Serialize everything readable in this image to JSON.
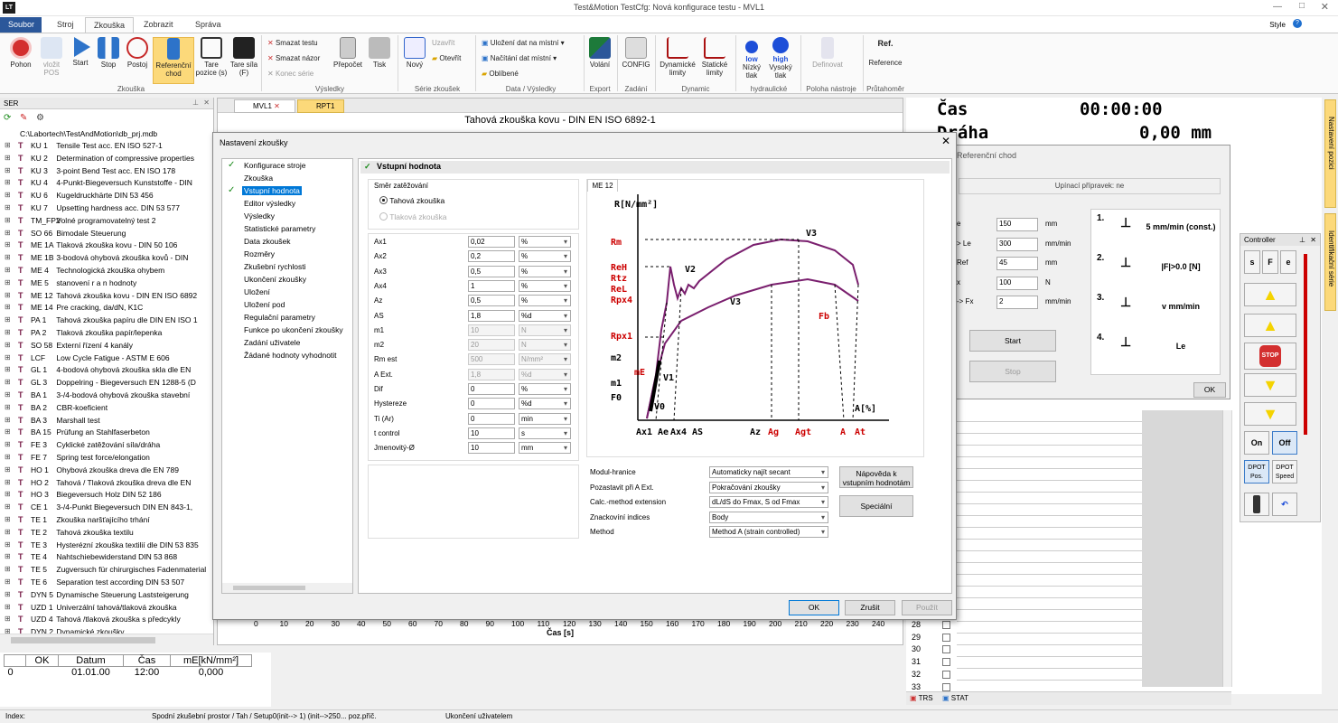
{
  "titlebar": {
    "title": "Test&Motion  TestCfg: Nová konfigurace testu - MVL1",
    "style": "Style"
  },
  "ribbon_tabs": [
    "Soubor",
    "Stroj",
    "Zkouška",
    "Zobrazit",
    "Správa"
  ],
  "ribbon": {
    "buttons": [
      {
        "label": "Pohon",
        "name": "pohon-button"
      },
      {
        "label": "vložit POS",
        "name": "vlozit-pos-button"
      },
      {
        "label": "Start",
        "name": "start-button"
      },
      {
        "label": "Stop",
        "name": "stop-button"
      },
      {
        "label": "Postoj",
        "name": "postoj-button"
      },
      {
        "label": "Referenční chod",
        "name": "referencni-chod-button"
      },
      {
        "label": "Tare pozice (s)",
        "name": "tare-pozice-button"
      },
      {
        "label": "Tare síla (F)",
        "name": "tare-sila-button"
      }
    ],
    "small_items": [
      "Smazat testu",
      "Smazat názor",
      "Konec série",
      "Přepočet",
      "Tisk",
      "Nový",
      "Uzavřít",
      "Otevřít",
      "Uložení dat na místní",
      "Načítání dat místní",
      "Oblíbené",
      "Volání",
      "CONFIG",
      "Dynamické limity",
      "Statické limity",
      "Nízký tlak",
      "Vysoký tlak",
      "Definovat",
      "Reference"
    ],
    "groups": [
      "Zkouška",
      "Výsledky",
      "Série zkoušek",
      "Data / Výsledky",
      "Export",
      "Zadání",
      "Dynamic",
      "hydraulické",
      "Poloha nástroje",
      "Průtahoměr"
    ],
    "icon_text": {
      "low": "low",
      "high": "high",
      "ref": "Ref."
    }
  },
  "left_panel": {
    "title": "SER",
    "path": "C:\\Labortech\\TestAndMotion\\db_prj.mdb",
    "items": [
      [
        "KU 1",
        "Tensile Test acc. EN ISO 527-1"
      ],
      [
        "KU 2",
        "Determination of compressive properties"
      ],
      [
        "KU 3",
        "3-point Bend Test acc. EN ISO 178"
      ],
      [
        "KU 4",
        "4-Punkt-Biegeversuch Kunststoffe - DIN"
      ],
      [
        "KU 6",
        "Kugeldruckhärte DIN 53 456"
      ],
      [
        "KU 7",
        "Upsetting hardness acc. DIN 53 577"
      ],
      [
        "TM_FP2",
        "Volné programovatelný test 2"
      ],
      [
        "SO 66",
        "Bimodale Steuerung"
      ],
      [
        "ME 1A",
        "Tlaková zkouška kovu - DIN 50 106"
      ],
      [
        "ME 1B",
        "3-bodová ohybová zkouška kovů - DIN"
      ],
      [
        "ME 4",
        "Technologická zkouška ohybem"
      ],
      [
        "ME 5",
        "stanovení r a n hodnoty"
      ],
      [
        "ME 12",
        "Tahová zkouška kovu - DIN EN ISO 6892"
      ],
      [
        "ME 14",
        "Pre cracking, da/dN, K1C"
      ],
      [
        "PA 1",
        "Tahová zkouška papíru dle DIN EN ISO 1"
      ],
      [
        "PA 2",
        "Tlaková zkouška papír/lepenka"
      ],
      [
        "SO 58",
        "Externí řízení 4 kanály"
      ],
      [
        "LCF",
        "Low Cycle Fatigue - ASTM E 606"
      ],
      [
        "GL 1",
        "4-bodová ohybová zkouška skla dle EN"
      ],
      [
        "GL 3",
        "Doppelring - Biegeversuch EN 1288-5 (D"
      ],
      [
        "BA 1",
        "3-/4-bodová ohybová zkouška stavební"
      ],
      [
        "BA 2",
        "CBR-koeficient"
      ],
      [
        "BA 3",
        "Marshall test"
      ],
      [
        "BA 15",
        "Prüfung an Stahlfaserbeton"
      ],
      [
        "FE 3",
        "Cyklické zatěžování síla/dráha"
      ],
      [
        "FE 7",
        "Spring test force/elongation"
      ],
      [
        "HO 1",
        "Ohybová zkouška dreva dle EN 789"
      ],
      [
        "HO 2",
        "Tahová / Tlaková zkouška dreva dle EN"
      ],
      [
        "HO 3",
        "Biegeversuch Holz  DIN 52 186"
      ],
      [
        "CE 1",
        "3-/4-Punkt Biegeversuch DIN EN 843-1,"
      ],
      [
        "TE 1",
        "Zkouška naršťajícího trhání"
      ],
      [
        "TE 2",
        "Tahová zkouška textilu"
      ],
      [
        "TE 3",
        "Hysterézní zkouška textilií dle DIN 53 835"
      ],
      [
        "TE 4",
        "Nahtschiebewiderstand DIN 53 868"
      ],
      [
        "TE 5",
        "Zugversuch für chirurgisches Fadenmaterial"
      ],
      [
        "TE 6",
        "Separation test according DIN 53 507"
      ],
      [
        "DYN 5",
        "Dynamische Steuerung Laststeigerung"
      ],
      [
        "UZD 1",
        "Univerzální tahová/tlaková zkouška"
      ],
      [
        "UZD 4",
        "Tahová /tlaková zkouška s předcykly"
      ],
      [
        "DYN 2",
        "Dynamické zkoušky"
      ]
    ]
  },
  "bottom_table": {
    "headers": [
      "OK",
      "Datum",
      "Čas",
      "mE[kN/mm²]"
    ],
    "row": [
      "0",
      "01.01.00",
      "12:00",
      "0,000"
    ]
  },
  "status_bar": {
    "index": "Index:",
    "text1": "Spodní zkušební prostor / Tah / Setup0(init--> 1)  (init-->250...  poz.příč.",
    "text2": "Ukončení uživatelem"
  },
  "doc": {
    "tabs": [
      "MVL1",
      "RPT1"
    ],
    "title": "Tahová zkouška kovu - DIN EN ISO 6892-1",
    "xaxis_ticks": [
      "0",
      "10",
      "20",
      "30",
      "40",
      "50",
      "60",
      "70",
      "80",
      "90",
      "100",
      "110",
      "120",
      "130",
      "140",
      "150",
      "160",
      "170",
      "180",
      "190",
      "200",
      "210",
      "220",
      "230",
      "240"
    ],
    "xlabel": "Čas [s]"
  },
  "right_panel": {
    "cas_label": "Čas",
    "cas_value": "00:00:00",
    "draha_label": "Dráha",
    "draha_value": "0,00 mm",
    "side_tabs": [
      "Nastavení pozici",
      "Identifikační série"
    ],
    "row_numbers": [
      "28",
      "29",
      "30",
      "31",
      "32",
      "33"
    ],
    "bottom_tabs": [
      "TRS",
      "STAT"
    ]
  },
  "ref_dialog": {
    "title": "Referenční chod",
    "fixture": "Upínací přípravek: ne",
    "rows": [
      {
        "label": "e",
        "value": "150",
        "unit": "mm"
      },
      {
        "label": "> Le",
        "value": "300",
        "unit": "mm/min"
      },
      {
        "label": "Ref",
        "value": "45",
        "unit": "mm"
      },
      {
        "label": "x",
        "value": "100",
        "unit": "N"
      },
      {
        "label": "-> Fx",
        "value": "2",
        "unit": "mm/min"
      }
    ],
    "start": "Start",
    "stop": "Stop",
    "ok": "OK",
    "steps": [
      {
        "n": "1.",
        "text": "5 mm/min (const.)"
      },
      {
        "n": "2.",
        "text": "|F|>0.0 [N]"
      },
      {
        "n": "3.",
        "text": "v mm/min"
      },
      {
        "n": "4.",
        "text": "Le"
      }
    ]
  },
  "controller": {
    "title": "Controller",
    "buttons": [
      "s",
      "F",
      "e",
      "STOP",
      "On",
      "Off",
      "DPOT Pos.",
      "DPOT Speed"
    ]
  },
  "dialog": {
    "title": "Nastavení zkoušky",
    "tree": [
      "Konfigurace stroje",
      "Zkouška",
      "Vstupní hodnota",
      "Editor výsledky",
      "Výsledky",
      "Statistické parametry",
      "Data zkoušek",
      "Rozměry",
      "Zkušební rychlosti",
      "Ukončení zkoušky",
      "Uložení",
      "Uložení pod",
      "Regulační parametry",
      "Funkce po ukončení zkoušky",
      "Zadání uživatele",
      "Žádané hodnoty vyhodnotit"
    ],
    "section": "Vstupní hodnota",
    "direction_label": "Směr zatěžování",
    "radio_tah": "Tahová zkouška",
    "radio_tlak": "Tlaková zkouška",
    "params": [
      {
        "label": "Ax1",
        "value": "0,02",
        "unit": "%",
        "enabled": true
      },
      {
        "label": "Ax2",
        "value": "0,2",
        "unit": "%",
        "enabled": true
      },
      {
        "label": "Ax3",
        "value": "0,5",
        "unit": "%",
        "enabled": true
      },
      {
        "label": "Ax4",
        "value": "1",
        "unit": "%",
        "enabled": true
      },
      {
        "label": "Az",
        "value": "0,5",
        "unit": "%",
        "enabled": true
      },
      {
        "label": "AS",
        "value": "1,8",
        "unit": "%d",
        "enabled": true
      },
      {
        "label": "m1",
        "value": "10",
        "unit": "N",
        "enabled": false
      },
      {
        "label": "m2",
        "value": "20",
        "unit": "N",
        "enabled": false
      },
      {
        "label": "Rm est",
        "value": "500",
        "unit": "N/mm²",
        "enabled": false
      },
      {
        "label": "A Ext.",
        "value": "1,8",
        "unit": "%d",
        "enabled": false
      },
      {
        "label": "Dif",
        "value": "0",
        "unit": "%",
        "enabled": true
      },
      {
        "label": "Hystereze",
        "value": "0",
        "unit": "%d",
        "enabled": true
      },
      {
        "label": "Ti (Ar)",
        "value": "0",
        "unit": "min",
        "enabled": true
      },
      {
        "label": "t control",
        "value": "10",
        "unit": "s",
        "enabled": true
      },
      {
        "label": "Jmenovitý-Ø",
        "value": "10",
        "unit": "mm",
        "enabled": true
      }
    ],
    "chart_tab": "ME 12",
    "chart_labels": {
      "y": "R[N/mm²]",
      "Rm": "Rm",
      "ReH": "ReH",
      "Rtz": "Rtz",
      "ReL": "ReL",
      "Rpx4": "Rpx4",
      "Rpx1": "Rpx1",
      "m2": "m2",
      "mE": "mE",
      "m1": "m1",
      "F0": "F0",
      "V0": "V0",
      "V1": "V1",
      "V2": "V2",
      "V3a": "V3",
      "V3b": "V3",
      "Fb": "Fb",
      "Ax": "A[%]",
      "x": [
        "Ax1",
        "Ae",
        "Ax4",
        "AS",
        "Az",
        "Ag",
        "Agt",
        "A",
        "At"
      ]
    },
    "options": [
      {
        "label": "Modul-hranice",
        "value": "Automaticky najít secant"
      },
      {
        "label": "Pozastavit při A Ext.",
        "value": "Pokračování zkoušky"
      },
      {
        "label": "Calc.-method extension",
        "value": "dL/dS do Fmax, S od Fmax"
      },
      {
        "label": "Znackovíní indices",
        "value": "Body"
      },
      {
        "label": "Method",
        "value": "Method A (strain controlled)"
      }
    ],
    "help_btn": "Nápověda k vstupním hodnotám",
    "special_btn": "Speciální",
    "ok": "OK",
    "cancel": "Zrušit",
    "apply": "Použít"
  }
}
